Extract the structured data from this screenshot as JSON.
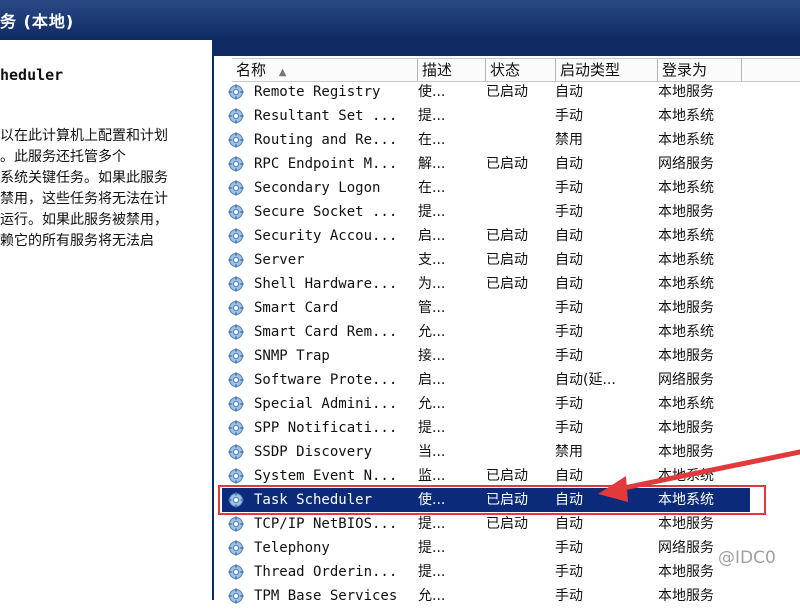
{
  "window": {
    "title": "务 (本地)"
  },
  "left_pane": {
    "service_title": "heduler",
    "description": "以在此计算机上配置和计划\n。此服务还托管多个\n系统关键任务。如果此服务\n禁用，这些任务将无法在计\n运行。如果此服务被禁用，\n赖它的所有服务将无法启"
  },
  "table": {
    "columns": [
      "名称",
      "描述",
      "状态",
      "启动类型",
      "登录为"
    ],
    "sort_indicator": "▲",
    "rows": [
      {
        "name": "Remote Registry",
        "desc": "使...",
        "status": "已启动",
        "startup": "自动",
        "logon": "本地服务"
      },
      {
        "name": "Resultant Set ...",
        "desc": "提...",
        "status": "",
        "startup": "手动",
        "logon": "本地系统"
      },
      {
        "name": "Routing and Re...",
        "desc": "在...",
        "status": "",
        "startup": "禁用",
        "logon": "本地系统"
      },
      {
        "name": "RPC Endpoint M...",
        "desc": "解...",
        "status": "已启动",
        "startup": "自动",
        "logon": "网络服务"
      },
      {
        "name": "Secondary Logon",
        "desc": "在...",
        "status": "",
        "startup": "手动",
        "logon": "本地系统"
      },
      {
        "name": "Secure Socket ...",
        "desc": "提...",
        "status": "",
        "startup": "手动",
        "logon": "本地服务"
      },
      {
        "name": "Security Accou...",
        "desc": "启...",
        "status": "已启动",
        "startup": "自动",
        "logon": "本地系统"
      },
      {
        "name": "Server",
        "desc": "支...",
        "status": "已启动",
        "startup": "自动",
        "logon": "本地系统"
      },
      {
        "name": "Shell Hardware...",
        "desc": "为...",
        "status": "已启动",
        "startup": "自动",
        "logon": "本地系统"
      },
      {
        "name": "Smart Card",
        "desc": "管...",
        "status": "",
        "startup": "手动",
        "logon": "本地服务"
      },
      {
        "name": "Smart Card Rem...",
        "desc": "允...",
        "status": "",
        "startup": "手动",
        "logon": "本地系统"
      },
      {
        "name": "SNMP Trap",
        "desc": "接...",
        "status": "",
        "startup": "手动",
        "logon": "本地服务"
      },
      {
        "name": "Software Prote...",
        "desc": "启...",
        "status": "",
        "startup": "自动(延...",
        "logon": "网络服务"
      },
      {
        "name": "Special Admini...",
        "desc": "允...",
        "status": "",
        "startup": "手动",
        "logon": "本地系统"
      },
      {
        "name": "SPP Notificati...",
        "desc": "提...",
        "status": "",
        "startup": "手动",
        "logon": "本地服务"
      },
      {
        "name": "SSDP Discovery",
        "desc": "当...",
        "status": "",
        "startup": "禁用",
        "logon": "本地服务"
      },
      {
        "name": "System Event N...",
        "desc": "监...",
        "status": "已启动",
        "startup": "自动",
        "logon": "本地系统"
      },
      {
        "name": "Task Scheduler",
        "desc": "使...",
        "status": "已启动",
        "startup": "自动",
        "logon": "本地系统",
        "selected": true
      },
      {
        "name": "TCP/IP NetBIOS...",
        "desc": "提...",
        "status": "已启动",
        "startup": "自动",
        "logon": "本地服务"
      },
      {
        "name": "Telephony",
        "desc": "提...",
        "status": "",
        "startup": "手动",
        "logon": "网络服务"
      },
      {
        "name": "Thread Orderin...",
        "desc": "提...",
        "status": "",
        "startup": "手动",
        "logon": "本地服务"
      },
      {
        "name": "TPM Base Services",
        "desc": "允...",
        "status": "",
        "startup": "手动",
        "logon": "本地服务"
      }
    ]
  },
  "colors": {
    "title_bar": "#0f2a63",
    "selection": "#0b2b7a",
    "annotation_red": "#e23a3a"
  },
  "icons": {
    "service": "gear-icon"
  },
  "watermark": "@IDC0"
}
